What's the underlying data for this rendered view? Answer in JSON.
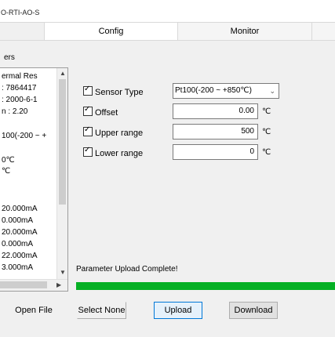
{
  "window": {
    "title": "O-RTI-AO-S"
  },
  "tabs": [
    {
      "label": ""
    },
    {
      "label": "Config"
    },
    {
      "label": "Monitor"
    },
    {
      "label": ""
    }
  ],
  "params_group": {
    "label": "ers"
  },
  "info_list": {
    "items": [
      "ermal Res",
      ": 7864417",
      ": 2000-6-1",
      "n : 2.20",
      "100(-200 ~ +",
      "0℃",
      "℃",
      "20.000mA",
      "0.000mA",
      "20.000mA",
      "0.000mA",
      "22.000mA",
      "3.000mA"
    ]
  },
  "form": {
    "sensor_type": {
      "label": "Sensor Type",
      "checked": true,
      "value": "Pt100(-200 ~ +850℃)"
    },
    "offset": {
      "label": "Offset",
      "checked": true,
      "value": "0.00",
      "unit": "℃"
    },
    "upper_range": {
      "label": "Upper range",
      "checked": true,
      "value": "500",
      "unit": "℃"
    },
    "lower_range": {
      "label": "Lower range",
      "checked": true,
      "value": "0",
      "unit": "℃"
    }
  },
  "status": {
    "text": "Parameter Upload Complete!",
    "progress_percent": 100,
    "progress_color": "#06b025"
  },
  "buttons": {
    "open_file": "Open File",
    "select_none": "Select None",
    "upload": "Upload",
    "download": "Download"
  }
}
